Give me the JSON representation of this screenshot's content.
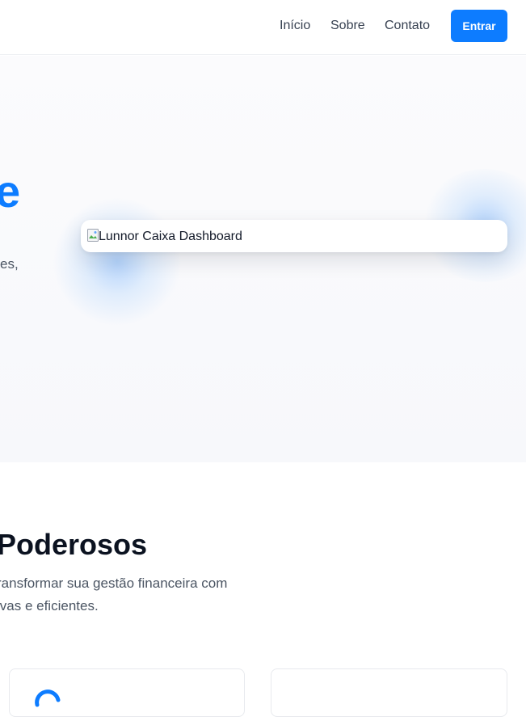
{
  "header": {
    "nav": {
      "inicio": "Início",
      "sobre": "Sobre",
      "contato": "Contato"
    },
    "login_label": "Entrar"
  },
  "hero": {
    "headline_fragment": "e",
    "subtitle_fragment": "es,",
    "dashboard_image_alt": "Lunnor Caixa Dashboard"
  },
  "features": {
    "title_fragment": "Poderosos",
    "description_fragment": "ransformar sua gestão financeira com ivas e eficientes."
  },
  "colors": {
    "accent": "#0d7cff",
    "heading": "#0b1220",
    "body_text": "#4b5563"
  }
}
